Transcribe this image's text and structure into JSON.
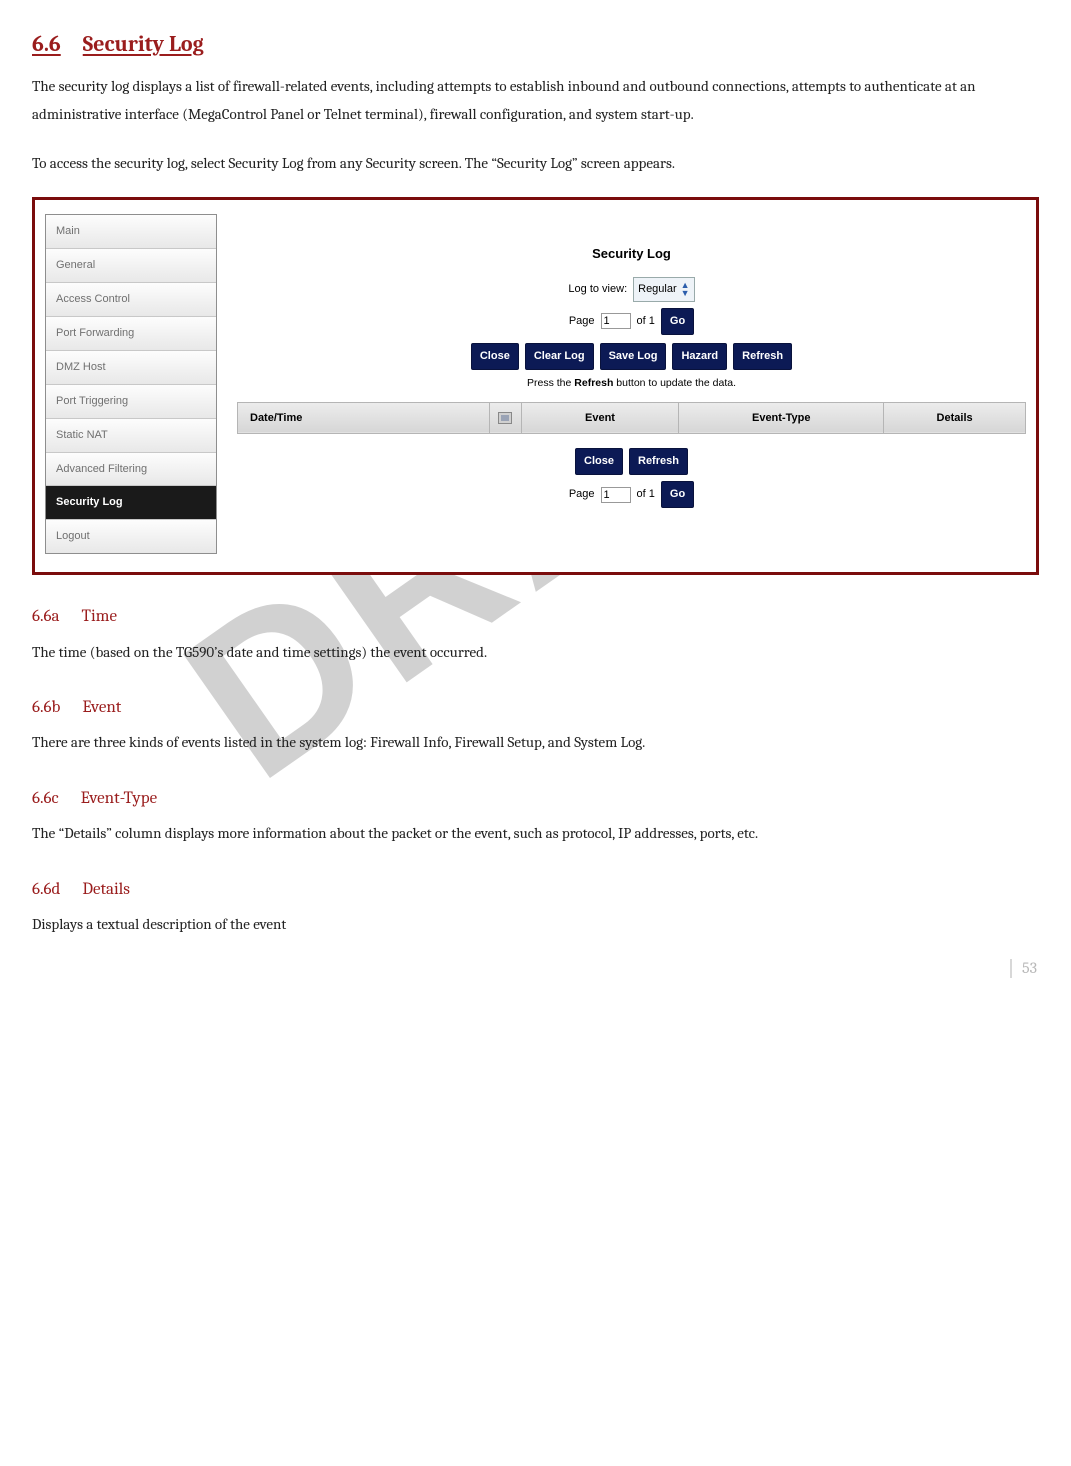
{
  "watermark": "DRAFT",
  "page_number": "53",
  "headings": {
    "main_num": "6.6",
    "main_title": "Security Log",
    "sub_a_num": "6.6a",
    "sub_a_title": "Time",
    "sub_b_num": "6.6b",
    "sub_b_title": "Event",
    "sub_c_num": "6.6c",
    "sub_c_title": "Event-Type",
    "sub_d_num": "6.6d",
    "sub_d_title": "Details"
  },
  "paragraphs": {
    "intro": "The security log displays a list of firewall-related events, including attempts to establish inbound and outbound connections, attempts to authenticate at an administrative interface (MegaControl Panel or Telnet terminal), firewall configuration, and system start-up.",
    "access": "To access the security log, select Security Log from any Security screen. The “Security Log” screen appears.",
    "time": "The time (based on the TG590’s date and time settings) the event occurred.",
    "event": "There are three kinds of events listed in the system log: Firewall Info, Firewall Setup, and System Log.",
    "event_type": "The “Details” column displays more information about the packet or the event, such as protocol, IP addresses, ports, etc.",
    "details": "Displays a textual description of the event"
  },
  "screenshot": {
    "sidebar": {
      "items": [
        {
          "label": "Main"
        },
        {
          "label": "General"
        },
        {
          "label": "Access Control"
        },
        {
          "label": "Port Forwarding"
        },
        {
          "label": "DMZ Host"
        },
        {
          "label": "Port Triggering"
        },
        {
          "label": "Static NAT"
        },
        {
          "label": "Advanced Filtering"
        },
        {
          "label": "Security Log"
        },
        {
          "label": "Logout"
        }
      ],
      "active_index": 8
    },
    "panel": {
      "title": "Security Log",
      "log_to_view_label": "Log to view:",
      "log_to_view_value": "Regular",
      "page_label_prefix": "Page",
      "page_value": "1",
      "page_label_suffix": "of 1",
      "go_label": "Go",
      "buttons_top": [
        "Close",
        "Clear Log",
        "Save Log",
        "Hazard",
        "Refresh"
      ],
      "refresh_note_prefix": "Press the ",
      "refresh_note_bold": "Refresh",
      "refresh_note_suffix": " button to update the data.",
      "columns": [
        "Date/Time",
        "Event",
        "Event-Type",
        "Details"
      ],
      "buttons_bottom": [
        "Close",
        "Refresh"
      ]
    }
  }
}
